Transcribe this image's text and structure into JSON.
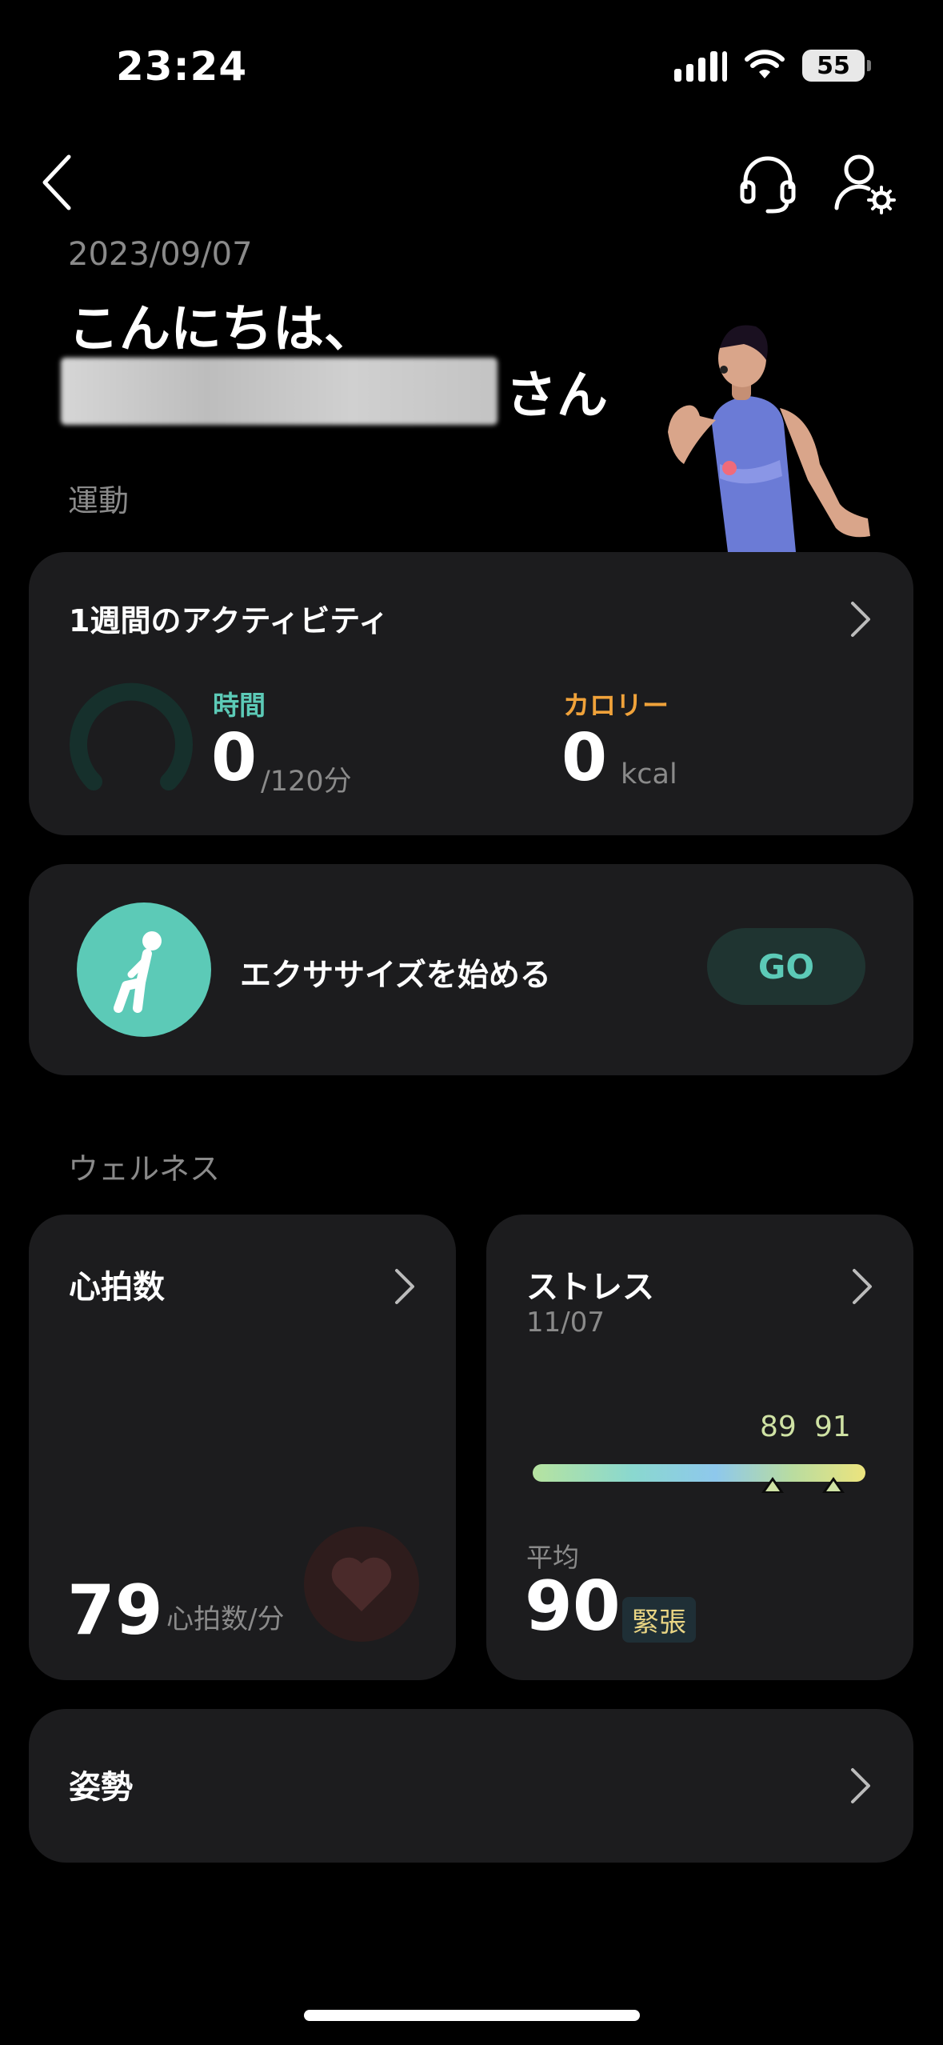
{
  "status_bar": {
    "time": "23:24",
    "battery": "55",
    "icons": [
      "cellular-signal-icon",
      "wifi-icon",
      "battery-icon"
    ]
  },
  "nav": {
    "icons": [
      "back-chevron-icon",
      "headset-support-icon",
      "user-settings-icon"
    ]
  },
  "header": {
    "date": "2023/09/07",
    "greeting": "こんにちは、",
    "name_suffix": "さん"
  },
  "sections": {
    "exercise": "運動",
    "wellness": "ウェルネス"
  },
  "activity_card": {
    "title": "1週間のアクティビティ",
    "ring_progress": 0,
    "time_label": "時間",
    "time_value": "0",
    "time_unit": "/120分",
    "calorie_label": "カロリー",
    "calorie_value": "0",
    "calorie_unit": "kcal"
  },
  "exercise_card": {
    "label": "エクササイズを始める",
    "go_label": "GO"
  },
  "heart_rate_card": {
    "title": "心拍数",
    "value": "79",
    "unit": "心拍数/分"
  },
  "stress_card": {
    "title": "ストレス",
    "date": "11/07",
    "markers": [
      "89",
      "91"
    ],
    "avg_label": "平均",
    "avg_value": "90",
    "level": "緊張"
  },
  "posture_card": {
    "title": "姿勢"
  },
  "colors": {
    "accent_teal": "#5ccab7",
    "accent_orange": "#f0a23a",
    "card_bg": "#1c1c1e",
    "page_bg": "#000000"
  }
}
